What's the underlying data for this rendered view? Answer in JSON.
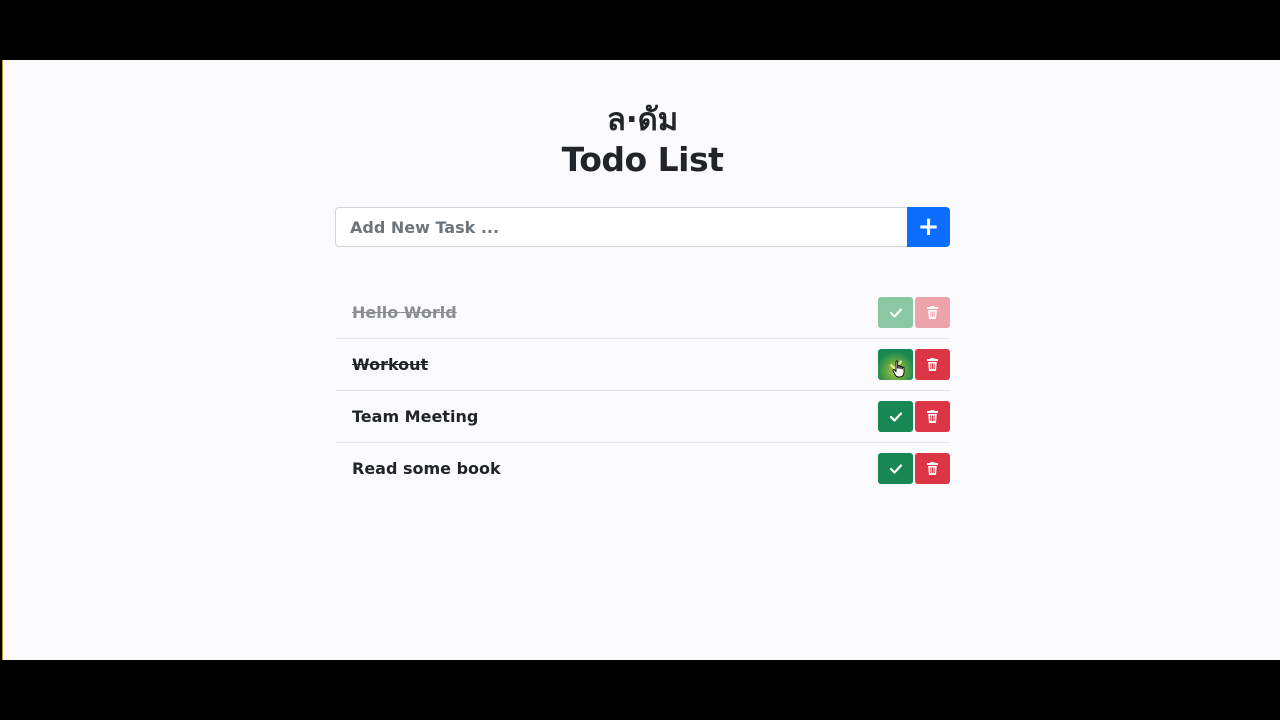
{
  "header": {
    "brand": "ล·ดัม",
    "title": "Todo List"
  },
  "add_form": {
    "placeholder": "Add New Task ...",
    "value": "",
    "add_button_label": "+"
  },
  "tasks": [
    {
      "label": "Hello World",
      "completed": true,
      "faded": true
    },
    {
      "label": "Workout",
      "completed": true,
      "faded": false
    },
    {
      "label": "Team Meeting",
      "completed": false,
      "faded": false
    },
    {
      "label": "Read some book",
      "completed": false,
      "faded": false
    }
  ],
  "icons": {
    "done": "check-icon",
    "delete": "trash-icon",
    "add": "plus-icon"
  },
  "colors": {
    "primary": "#0d6efd",
    "success": "#198754",
    "danger": "#dc3545",
    "background": "#fbfafc",
    "text": "#212529"
  }
}
